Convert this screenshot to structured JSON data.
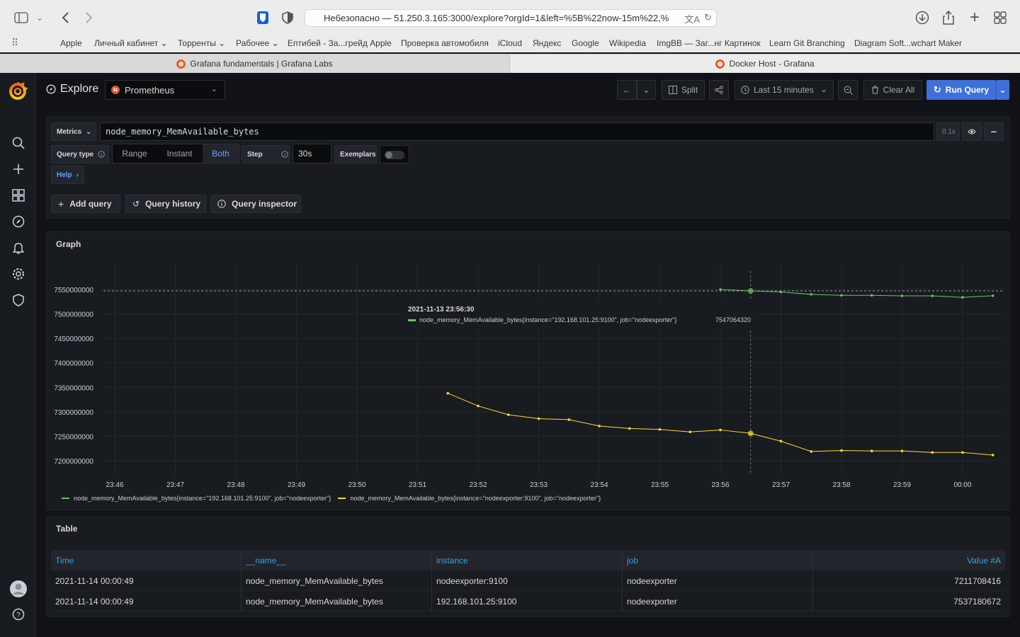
{
  "browser": {
    "address": "Небезопасно — 51.250.3.165:3000/explore?orgId=1&left=%5B%22now-15m%22,%",
    "bookmarks": [
      "Apple",
      "Личный кабинет ⌄",
      "Торренты ⌄",
      "Рабочее ⌄",
      "Ептибей - За...грейд Apple",
      "Проверка автомобиля",
      "iCloud",
      "Яндекс",
      "Google",
      "Wikipedia",
      "ImgBB — Заг...нг Картинок",
      "Learn Git Branching",
      "Diagram Soft...wchart Maker"
    ],
    "tabs": [
      "Grafana fundamentals | Grafana Labs",
      "Docker Host - Grafana"
    ]
  },
  "header": {
    "title": "Explore",
    "datasource": "Prometheus",
    "split_label": "Split",
    "time_range": "Last 15 minutes",
    "clear_all": "Clear All",
    "run_query": "Run Query"
  },
  "query": {
    "metrics_label": "Metrics",
    "expression": "node_memory_MemAvailable_bytes",
    "duration": "0.1s",
    "query_type_label": "Query type",
    "types": [
      "Range",
      "Instant",
      "Both"
    ],
    "active_type": "Both",
    "step_label": "Step",
    "step_value": "30s",
    "exemplars_label": "Exemplars",
    "help_label": "Help",
    "add_query": "Add query",
    "query_history": "Query history",
    "query_inspector": "Query inspector"
  },
  "graph": {
    "title": "Graph",
    "tooltip_time": "2021-11-13 23:56:30",
    "tooltip_series": "node_memory_MemAvailable_bytes{instance=\"192.168.101.25:9100\", job=\"nodeexporter\"}",
    "tooltip_value": "7547064320"
  },
  "chart_data": {
    "type": "line",
    "title": "Graph",
    "ylim": [
      7180000000,
      7580000000
    ],
    "y_ticks": [
      "7200000000",
      "7250000000",
      "7300000000",
      "7350000000",
      "7400000000",
      "7450000000",
      "7500000000",
      "7550000000"
    ],
    "x_ticks": [
      "23:46",
      "23:47",
      "23:48",
      "23:49",
      "23:50",
      "23:51",
      "23:52",
      "23:53",
      "23:54",
      "23:55",
      "23:56",
      "23:57",
      "23:58",
      "23:59",
      "00:00"
    ],
    "grid": true,
    "legend": "bottom",
    "series": [
      {
        "name": "node_memory_MemAvailable_bytes{instance=\"192.168.101.25:9100\", job=\"nodeexporter\"}",
        "color": "#73bf69",
        "x": [
          "23:56:00",
          "23:56:30",
          "23:57:00",
          "23:57:30",
          "23:58:00",
          "23:58:30",
          "23:59:00",
          "23:59:30",
          "00:00:00",
          "00:00:30"
        ],
        "values": [
          7550000000,
          7547064320,
          7545000000,
          7540000000,
          7538000000,
          7538000000,
          7537000000,
          7537000000,
          7534000000,
          7537180672
        ]
      },
      {
        "name": "node_memory_MemAvailable_bytes{instance=\"nodeexporter:9100\", job=\"nodeexporter\"}",
        "color": "#fade2a",
        "x": [
          "23:51:30",
          "23:52:00",
          "23:52:30",
          "23:53:00",
          "23:53:30",
          "23:54:00",
          "23:54:30",
          "23:55:00",
          "23:55:30",
          "23:56:00",
          "23:56:30",
          "23:57:00",
          "23:57:30",
          "23:58:00",
          "23:58:30",
          "23:59:00",
          "23:59:30",
          "00:00:00",
          "00:00:30"
        ],
        "values": [
          7338000000,
          7312000000,
          7294000000,
          7286000000,
          7284000000,
          7271000000,
          7266000000,
          7264000000,
          7259000000,
          7263000000,
          7256000000,
          7240000000,
          7219000000,
          7221000000,
          7220000000,
          7220000000,
          7217000000,
          7217000000,
          7211708416
        ]
      }
    ]
  },
  "table": {
    "title": "Table",
    "columns": [
      "Time",
      "__name__",
      "instance",
      "job",
      "Value #A"
    ],
    "rows": [
      [
        "2021-11-14 00:00:49",
        "node_memory_MemAvailable_bytes",
        "nodeexporter:9100",
        "nodeexporter",
        "7211708416"
      ],
      [
        "2021-11-14 00:00:49",
        "node_memory_MemAvailable_bytes",
        "192.168.101.25:9100",
        "nodeexporter",
        "7537180672"
      ]
    ]
  },
  "icons": [
    "sidebar-toggle-icon",
    "back-icon",
    "forward-icon",
    "bitwarden-icon",
    "shield-icon",
    "translate-icon",
    "reload-icon",
    "download-icon",
    "share-icon",
    "new-tab-icon",
    "tab-overview-icon",
    "apps-grid-icon",
    "grafana-logo",
    "search-icon",
    "plus-icon",
    "dashboards-icon",
    "explore-icon",
    "alert-bell-icon",
    "gear-icon",
    "shield-icon",
    "user-avatar",
    "help-icon"
  ],
  "colors": {
    "accent": "#3d71d9",
    "series_green": "#73bf69",
    "series_yellow": "#fade2a",
    "table_header": "#33a2e5"
  }
}
